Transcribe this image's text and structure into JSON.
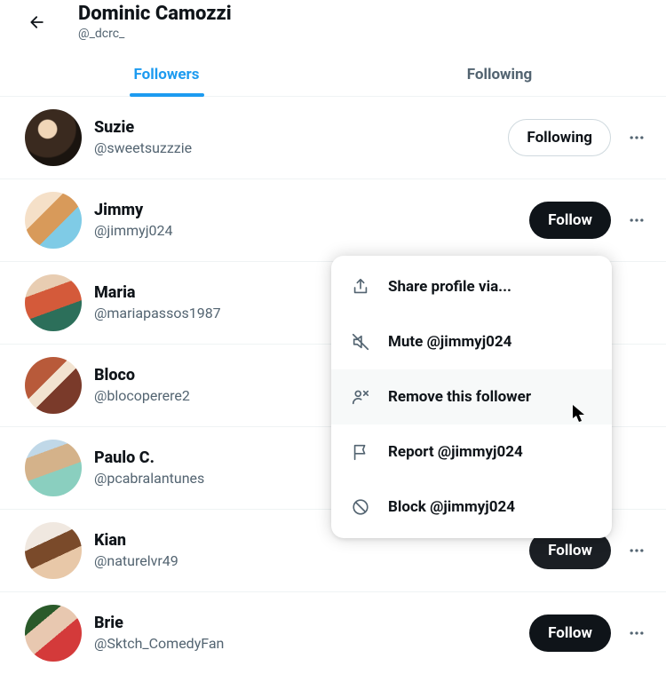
{
  "header": {
    "name": "Dominic Camozzi",
    "handle": "@_dcrc_"
  },
  "tabs": {
    "followers": "Followers",
    "following": "Following"
  },
  "buttons": {
    "follow": "Follow",
    "following": "Following"
  },
  "followers": [
    {
      "name": "Suzie",
      "handle": "@sweetsuzzzie",
      "state": "following"
    },
    {
      "name": "Jimmy",
      "handle": "@jimmyj024",
      "state": "follow"
    },
    {
      "name": "Maria",
      "handle": "@mariapassos1987",
      "state": "none"
    },
    {
      "name": "Bloco",
      "handle": "@blocoperere2",
      "state": "none"
    },
    {
      "name": "Paulo C.",
      "handle": "@pcabralantunes",
      "state": "none"
    },
    {
      "name": "Kian",
      "handle": "@naturelvr49",
      "state": "hidden-follow"
    },
    {
      "name": "Brie",
      "handle": "@Sktch_ComedyFan",
      "state": "follow"
    }
  ],
  "menu": {
    "share": "Share profile via...",
    "mute": "Mute @jimmyj024",
    "remove": "Remove this follower",
    "report": "Report @jimmyj024",
    "block": "Block @jimmyj024"
  }
}
